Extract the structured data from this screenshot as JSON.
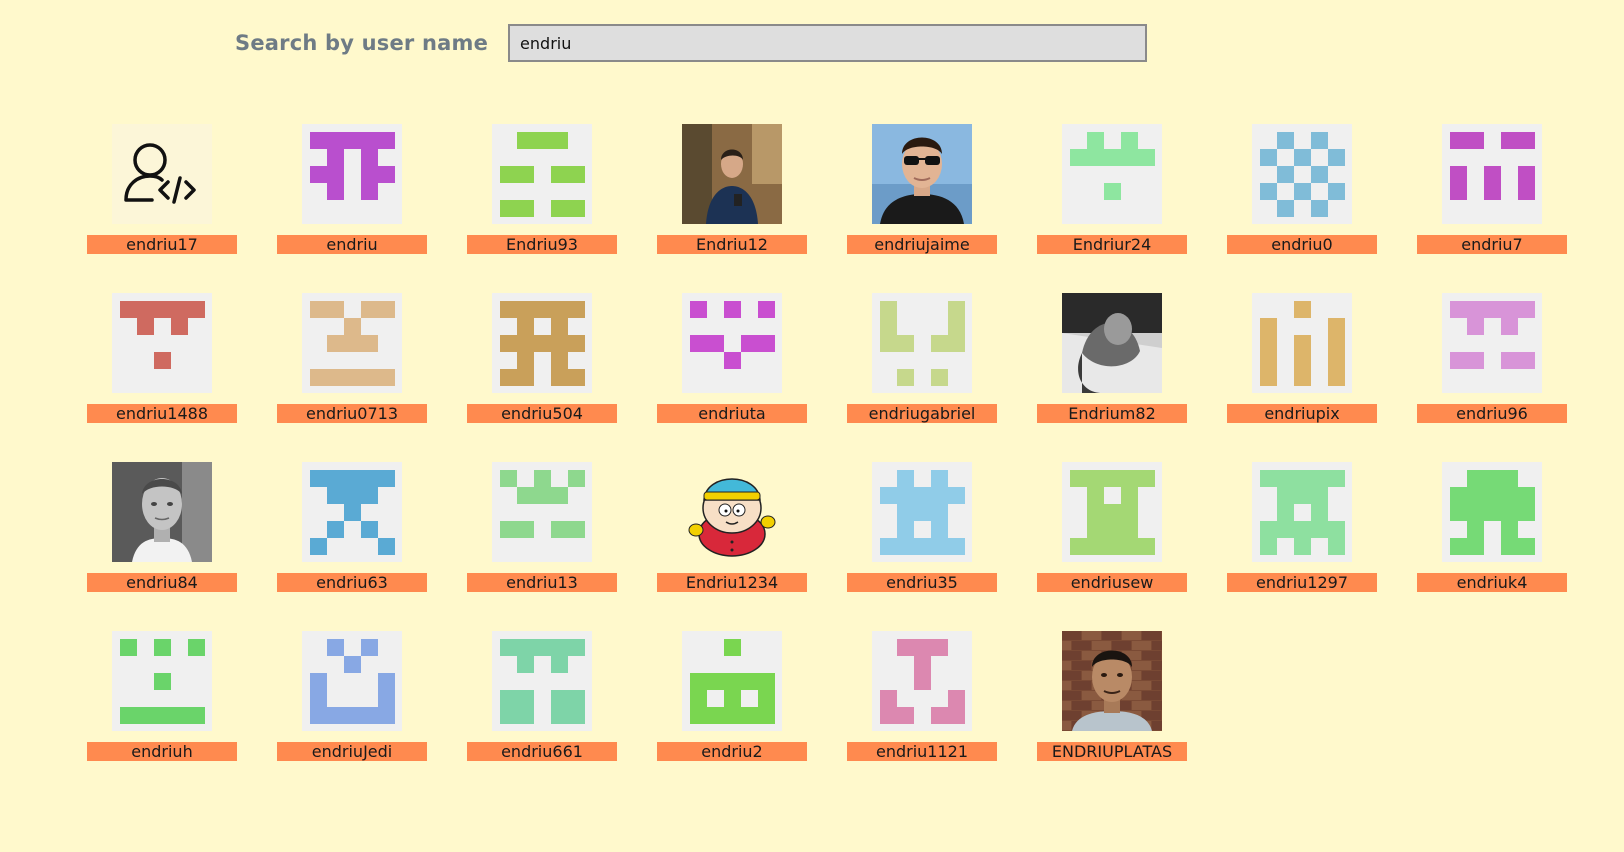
{
  "search": {
    "label": "Search by user name",
    "value": "endriu"
  },
  "users": [
    {
      "name": "endriu17",
      "avatar": {
        "type": "icon",
        "icon": "user-code-icon"
      }
    },
    {
      "name": "endriu",
      "avatar": {
        "type": "identicon",
        "color": "#b94fce",
        "cells": [
          "11111",
          "01010",
          "11011",
          "01010",
          "00000"
        ]
      }
    },
    {
      "name": "Endriu93",
      "avatar": {
        "type": "identicon",
        "color": "#8ed350",
        "cells": [
          "01110",
          "00000",
          "11011",
          "00000",
          "11011"
        ]
      }
    },
    {
      "name": "Endriu12",
      "avatar": {
        "type": "photo",
        "photo": "man-blue-shirt"
      }
    },
    {
      "name": "endriujaime",
      "avatar": {
        "type": "photo",
        "photo": "man-sunglasses"
      }
    },
    {
      "name": "Endriur24",
      "avatar": {
        "type": "identicon",
        "color": "#8ee6a0",
        "cells": [
          "01010",
          "11111",
          "00000",
          "00100",
          "00000"
        ]
      }
    },
    {
      "name": "endriu0",
      "avatar": {
        "type": "identicon",
        "color": "#80bcd8",
        "cells": [
          "01010",
          "10101",
          "01010",
          "10101",
          "01010"
        ]
      }
    },
    {
      "name": "endriu7",
      "avatar": {
        "type": "identicon",
        "color": "#c04fc4",
        "cells": [
          "11011",
          "00000",
          "10101",
          "10101",
          "00000"
        ]
      }
    },
    {
      "name": "endriu1488",
      "avatar": {
        "type": "identicon",
        "color": "#cf6a60",
        "cells": [
          "11111",
          "01010",
          "00000",
          "00100",
          "00000"
        ]
      }
    },
    {
      "name": "endriu0713",
      "avatar": {
        "type": "identicon",
        "color": "#ddb98b",
        "cells": [
          "11011",
          "00100",
          "01110",
          "00000",
          "11111"
        ]
      }
    },
    {
      "name": "endriu504",
      "avatar": {
        "type": "identicon",
        "color": "#c9a05a",
        "cells": [
          "11111",
          "01010",
          "11111",
          "01010",
          "11011"
        ]
      }
    },
    {
      "name": "endriuta",
      "avatar": {
        "type": "identicon",
        "color": "#c94fd0",
        "cells": [
          "10101",
          "00000",
          "11011",
          "00100",
          "00000"
        ]
      }
    },
    {
      "name": "endriugabriel",
      "avatar": {
        "type": "identicon",
        "color": "#c6d88c",
        "cells": [
          "10001",
          "10001",
          "11011",
          "00000",
          "01010"
        ]
      }
    },
    {
      "name": "Endrium82",
      "avatar": {
        "type": "photo",
        "photo": "man-grayscale-bowing"
      }
    },
    {
      "name": "endriupix",
      "avatar": {
        "type": "identicon",
        "color": "#ddb56a",
        "cells": [
          "00100",
          "10001",
          "10101",
          "10101",
          "10101"
        ]
      }
    },
    {
      "name": "endriu96",
      "avatar": {
        "type": "identicon",
        "color": "#d894d8",
        "cells": [
          "11111",
          "01010",
          "00000",
          "11011",
          "00000"
        ]
      }
    },
    {
      "name": "endriu84",
      "avatar": {
        "type": "photo",
        "photo": "man-grayscale-portrait"
      }
    },
    {
      "name": "endriu63",
      "avatar": {
        "type": "identicon",
        "color": "#5aaad4",
        "cells": [
          "11111",
          "01110",
          "00100",
          "01010",
          "10001"
        ]
      }
    },
    {
      "name": "endriu13",
      "avatar": {
        "type": "identicon",
        "color": "#8ed88e",
        "cells": [
          "10101",
          "01110",
          "00000",
          "11011",
          "00000"
        ]
      }
    },
    {
      "name": "Endriu1234",
      "avatar": {
        "type": "icon",
        "icon": "cartoon-character-icon"
      }
    },
    {
      "name": "endriu35",
      "avatar": {
        "type": "identicon",
        "color": "#90cce8",
        "cells": [
          "01010",
          "11111",
          "01110",
          "01010",
          "11111"
        ]
      }
    },
    {
      "name": "endriusew",
      "avatar": {
        "type": "identicon",
        "color": "#a4d874",
        "cells": [
          "11111",
          "01010",
          "01110",
          "01110",
          "11111"
        ]
      }
    },
    {
      "name": "endriu1297",
      "avatar": {
        "type": "identicon",
        "color": "#8ee0a0",
        "cells": [
          "11111",
          "01110",
          "01010",
          "11111",
          "10101"
        ]
      }
    },
    {
      "name": "endriuk4",
      "avatar": {
        "type": "identicon",
        "color": "#76da76",
        "cells": [
          "01110",
          "11111",
          "11111",
          "01010",
          "11011"
        ]
      }
    },
    {
      "name": "endriuh",
      "avatar": {
        "type": "identicon",
        "color": "#6ad46a",
        "cells": [
          "10101",
          "00000",
          "00100",
          "00000",
          "11111"
        ]
      }
    },
    {
      "name": "endriuJedi",
      "avatar": {
        "type": "identicon",
        "color": "#88a8e4",
        "cells": [
          "01010",
          "00100",
          "10001",
          "10001",
          "11111"
        ]
      }
    },
    {
      "name": "endriu661",
      "avatar": {
        "type": "identicon",
        "color": "#7ed4a8",
        "cells": [
          "11111",
          "01010",
          "00000",
          "11011",
          "11011"
        ]
      }
    },
    {
      "name": "endriu2",
      "avatar": {
        "type": "identicon",
        "color": "#7ad650",
        "cells": [
          "00100",
          "00000",
          "11111",
          "10101",
          "11111"
        ]
      }
    },
    {
      "name": "endriu1121",
      "avatar": {
        "type": "identicon",
        "color": "#dc88b0",
        "cells": [
          "01110",
          "00100",
          "00100",
          "10001",
          "11011"
        ]
      }
    },
    {
      "name": "ENDRIUPLATAS",
      "avatar": {
        "type": "photo",
        "photo": "man-brick-wall"
      }
    }
  ]
}
